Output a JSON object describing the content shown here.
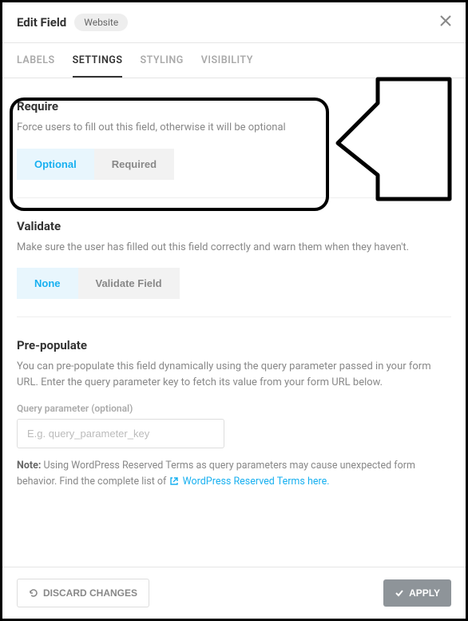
{
  "header": {
    "title": "Edit Field",
    "badge": "Website"
  },
  "tabs": {
    "labels": "LABELS",
    "settings": "SETTINGS",
    "styling": "STYLING",
    "visibility": "VISIBILITY"
  },
  "require": {
    "title": "Require",
    "desc": "Force users to fill out this field, otherwise it will be optional",
    "optional": "Optional",
    "required": "Required"
  },
  "validate": {
    "title": "Validate",
    "desc": "Make sure the user has filled out this field correctly and warn them when they haven't.",
    "none": "None",
    "validate_field": "Validate Field"
  },
  "prepopulate": {
    "title": "Pre-populate",
    "desc": "You can pre-populate this field dynamically using the query parameter passed in your form URL. Enter the query parameter key to fetch its value from your form URL below.",
    "field_label": "Query parameter (optional)",
    "placeholder": "E.g. query_parameter_key",
    "note_prefix": "Note:",
    "note_text": " Using WordPress Reserved Terms as query parameters may cause unexpected form behavior. Find the complete list of ",
    "link_text": "WordPress Reserved Terms here."
  },
  "footer": {
    "discard": "DISCARD CHANGES",
    "apply": "APPLY"
  }
}
